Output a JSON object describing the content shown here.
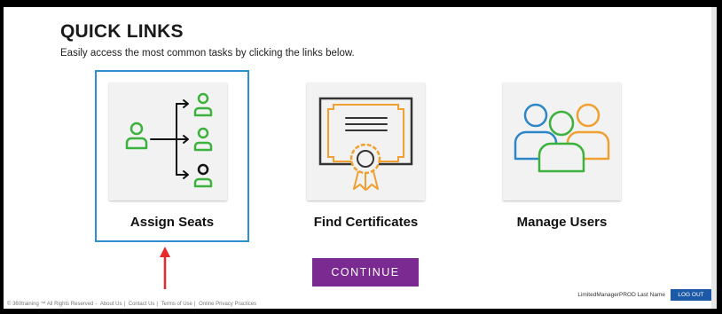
{
  "header": {
    "title": "QUICK LINKS",
    "subtitle": "Easily access the most common tasks by clicking the links below."
  },
  "cards": [
    {
      "label": "Assign Seats",
      "icon": "assign-seats-icon",
      "selected": true
    },
    {
      "label": "Find Certificates",
      "icon": "certificate-icon",
      "selected": false
    },
    {
      "label": "Manage Users",
      "icon": "users-group-icon",
      "selected": false
    }
  ],
  "actions": {
    "continue_label": "CONTINUE"
  },
  "user": {
    "name": "LimitedManagerPROD Last Name",
    "logout_label": "LOG OUT"
  },
  "footer": {
    "copyright": "© 360training ™ All Rights Reserved",
    "links": [
      "About Us",
      "Contact Us",
      "Terms of Use",
      "Online Privacy Practices"
    ]
  },
  "colors": {
    "accent": "#7b2a91",
    "selected_border": "#2d8fd0",
    "icon_green": "#3db13d",
    "icon_blue": "#2d86c6",
    "icon_orange": "#f0a030",
    "logout_blue": "#1c5aa8",
    "annotation_red": "#e8282a"
  }
}
